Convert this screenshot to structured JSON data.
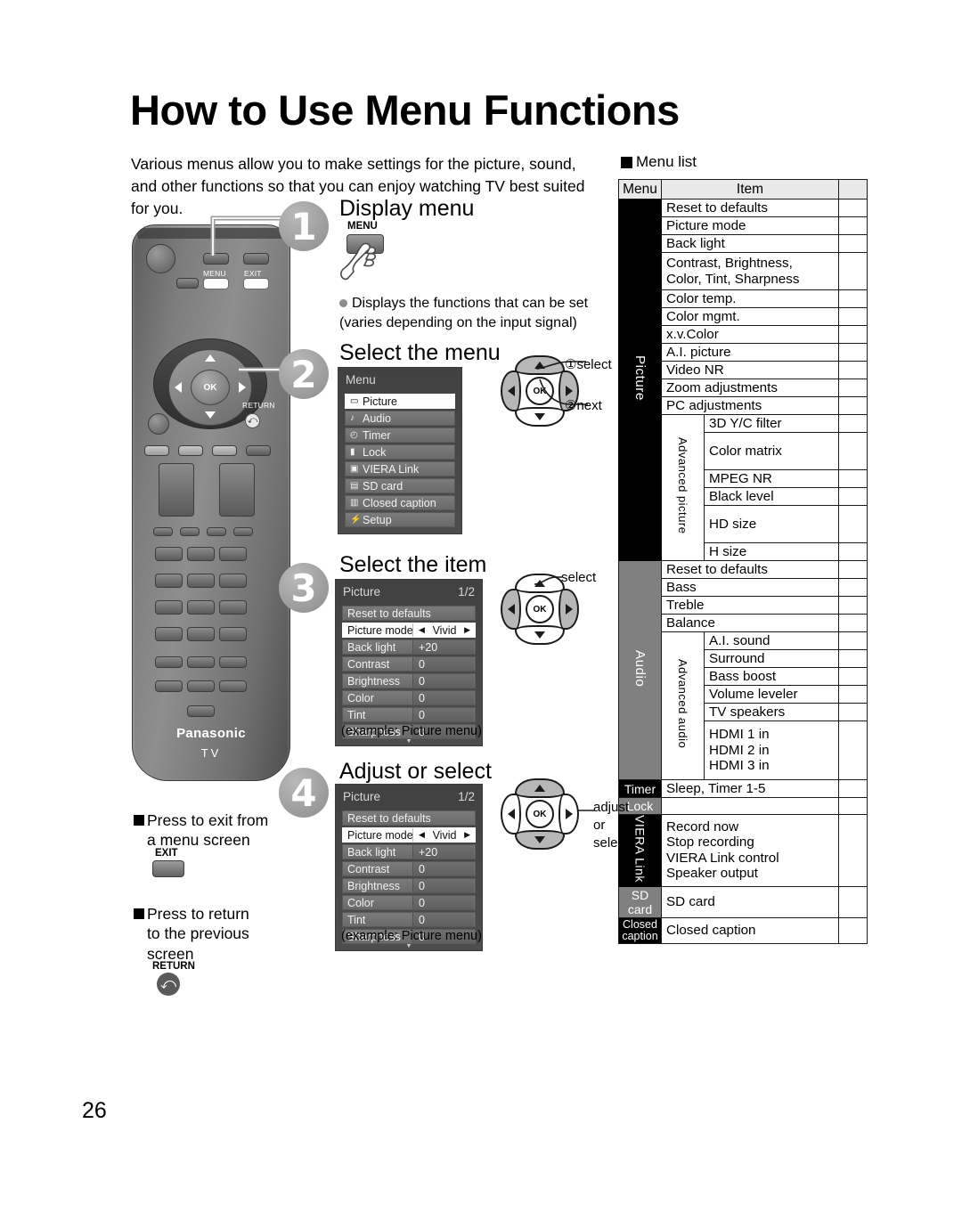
{
  "page": {
    "title": "How to Use Menu Functions",
    "intro": "Various menus allow you to make settings for the picture, sound, and other functions so that you can enjoy watching TV best suited for you.",
    "page_number": "26"
  },
  "remote": {
    "brand": "Panasonic",
    "model_label": "TV",
    "menu_key_label": "MENU",
    "exit_key_label": "EXIT",
    "return_key_label": "RETURN",
    "ok_label": "OK"
  },
  "steps": [
    {
      "number": "1",
      "title": "Display menu",
      "key_label": "MENU",
      "bullet": "Displays the functions that can be set",
      "bullet2": "(varies depending on the input signal)"
    },
    {
      "number": "2",
      "title": "Select the menu",
      "dpad": {
        "ok": "OK",
        "label1": "①select",
        "label2": "②next"
      },
      "osd": {
        "title": "Menu",
        "rows": [
          {
            "icon": "picture-icon",
            "glyph": "▭",
            "label": "Picture",
            "selected": true
          },
          {
            "icon": "audio-note-icon",
            "glyph": "♪",
            "label": "Audio",
            "selected": false
          },
          {
            "icon": "timer-clock-icon",
            "glyph": "◴",
            "label": "Timer",
            "selected": false
          },
          {
            "icon": "lock-icon",
            "glyph": "▮",
            "label": "Lock",
            "selected": false
          },
          {
            "icon": "viera-link-icon",
            "glyph": "▣",
            "label": "VIERA Link",
            "selected": false
          },
          {
            "icon": "sd-card-icon",
            "glyph": "▤",
            "label": "SD card",
            "selected": false
          },
          {
            "icon": "closed-caption-icon",
            "glyph": "▥",
            "label": "Closed caption",
            "selected": false
          },
          {
            "icon": "setup-wrench-icon",
            "glyph": "⚡",
            "label": "Setup",
            "selected": false
          }
        ]
      }
    },
    {
      "number": "3",
      "title": "Select the item",
      "dpad": {
        "ok": "OK",
        "label1": "select"
      },
      "caption": "(example:  Picture menu)",
      "osd": {
        "title": "Picture",
        "page_indicator": "1/2",
        "rows": [
          {
            "label": "Reset to defaults",
            "value": "",
            "selected": false,
            "novalue": true
          },
          {
            "label": "Picture mode",
            "value": "Vivid",
            "selected": true
          },
          {
            "label": "Back light",
            "value": "+20",
            "selected": false
          },
          {
            "label": "Contrast",
            "value": "0",
            "selected": false
          },
          {
            "label": "Brightness",
            "value": "0",
            "selected": false
          },
          {
            "label": "Color",
            "value": "0",
            "selected": false
          },
          {
            "label": "Tint",
            "value": "0",
            "selected": false
          },
          {
            "label": "Sharpness",
            "value": "0",
            "selected": false
          }
        ]
      }
    },
    {
      "number": "4",
      "title": "Adjust or select",
      "dpad": {
        "ok": "OK",
        "label1": "adjust",
        "label2": "or",
        "label3": "select"
      },
      "caption": "(example:  Picture menu)",
      "osd": {
        "title": "Picture",
        "page_indicator": "1/2",
        "rows": [
          {
            "label": "Reset to defaults",
            "value": "",
            "selected": false,
            "novalue": true
          },
          {
            "label": "Picture mode",
            "value": "Vivid",
            "selected": true
          },
          {
            "label": "Back light",
            "value": "+20",
            "selected": false
          },
          {
            "label": "Contrast",
            "value": "0",
            "selected": false
          },
          {
            "label": "Brightness",
            "value": "0",
            "selected": false
          },
          {
            "label": "Color",
            "value": "0",
            "selected": false
          },
          {
            "label": "Tint",
            "value": "0",
            "selected": false
          },
          {
            "label": "Sharpness",
            "value": "0",
            "selected": false
          }
        ]
      }
    }
  ],
  "notes": [
    {
      "line1": "Press to exit from",
      "line2": "a menu screen",
      "key": "EXIT"
    },
    {
      "line1": "Press to return",
      "line2": "to the previous",
      "line3": "screen",
      "key": "RETURN"
    }
  ],
  "menu_list": {
    "heading": "Menu list",
    "columns": {
      "menu": "Menu",
      "item": "Item",
      "page": ""
    },
    "groups": [
      {
        "name": "Picture",
        "style": "black",
        "rows": [
          {
            "item": "Reset to defaults"
          },
          {
            "item": "Picture mode"
          },
          {
            "item": "Back light"
          },
          {
            "item": "Contrast, Brightness,\nColor, Tint, Sharpness",
            "tall": true
          },
          {
            "item": "Color temp."
          },
          {
            "item": "Color mgmt."
          },
          {
            "item": "x.v.Color"
          },
          {
            "item": "A.I. picture"
          },
          {
            "item": "Video NR"
          },
          {
            "item": "Zoom adjustments"
          },
          {
            "item": "PC adjustments"
          }
        ],
        "sub": {
          "name": "Advanced picture",
          "rows": [
            {
              "item": "3D Y/C filter"
            },
            {
              "item": "Color matrix",
              "tall": true
            },
            {
              "item": "MPEG NR"
            },
            {
              "item": "Black level"
            },
            {
              "item": "HD size",
              "tall": true
            },
            {
              "item": "H size"
            }
          ]
        }
      },
      {
        "name": "Audio",
        "style": "gray",
        "rows": [
          {
            "item": "Reset to defaults"
          },
          {
            "item": "Bass"
          },
          {
            "item": "Treble"
          },
          {
            "item": "Balance"
          }
        ],
        "sub": {
          "name": "Advanced audio",
          "rows": [
            {
              "item": "A.I. sound"
            },
            {
              "item": "Surround"
            },
            {
              "item": "Bass boost"
            },
            {
              "item": "Volume leveler"
            },
            {
              "item": "TV speakers"
            },
            {
              "item": "HDMI 1 in\nHDMI 2 in\nHDMI 3 in",
              "tall": true
            }
          ]
        }
      },
      {
        "name": "Timer",
        "style": "badge-black",
        "rows": [
          {
            "item": "Sleep, Timer 1-5"
          }
        ]
      },
      {
        "name": "Lock",
        "style": "badge-gray",
        "rows": [
          {
            "item": ""
          }
        ]
      },
      {
        "name": "VIERA Link",
        "style": "black-two",
        "rows": [
          {
            "item": "Record now\nStop recording\nVIERA Link control\nSpeaker output",
            "tall": true
          }
        ]
      },
      {
        "name": "SD card",
        "style": "badge-gray",
        "rows": [
          {
            "item": "SD card"
          }
        ]
      },
      {
        "name": "Closed caption",
        "style": "badge-black-two",
        "rows": [
          {
            "item": "Closed caption"
          }
        ]
      }
    ]
  }
}
